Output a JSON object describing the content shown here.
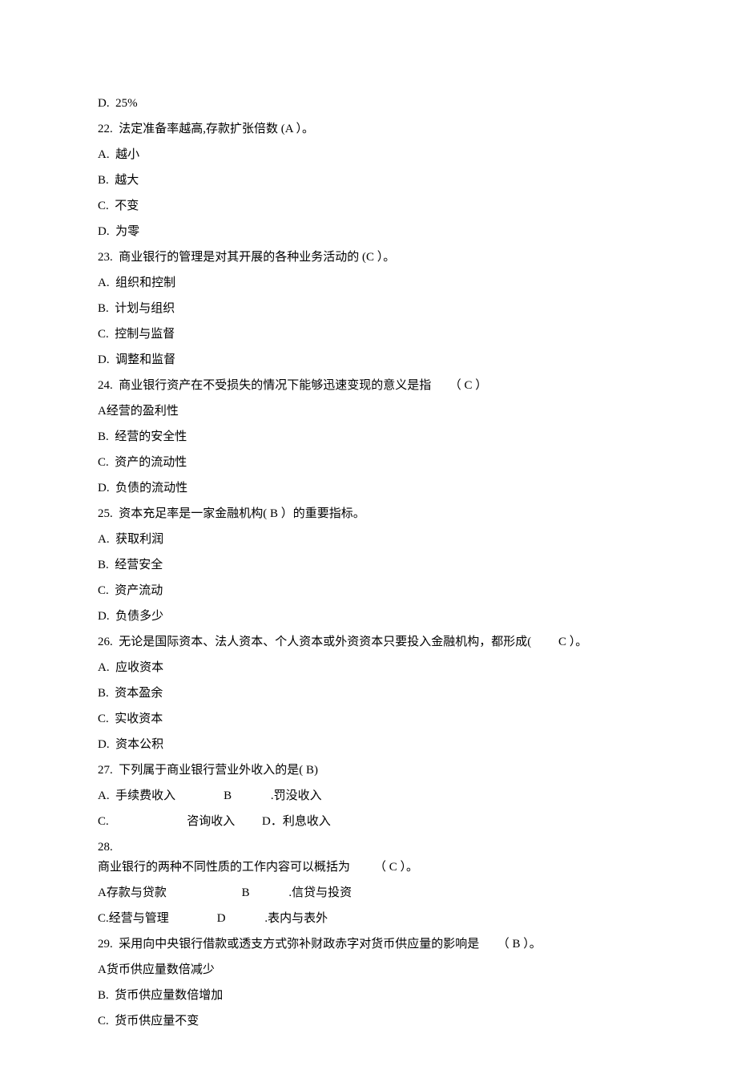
{
  "lines": {
    "l1": "D.  25%",
    "l2": "22.  法定准备率越高,存款扩张倍数 (A ）。",
    "l3": "A.  越小",
    "l4": "B.  越大",
    "l5": "C.  不变",
    "l6": "D.  为零",
    "l7": "23.  商业银行的管理是对其开展的各种业务活动的 (C ）。",
    "l8": "A.  组织和控制",
    "l9": "B.  计划与组织",
    "l10": "C.  控制与监督",
    "l11": "D.  调整和监督",
    "l12": "24.  商业银行资产在不受损失的情况下能够迅速变现的意义是指      （ C ）",
    "l13": "A经营的盈利性",
    "l14": "B.  经营的安全性",
    "l15": "C.  资产的流动性",
    "l16": "D.  负债的流动性",
    "l17": "25.  资本充足率是一家金融机构( B ）的重要指标。",
    "l18": "A.  获取利润",
    "l19": "B.  经营安全",
    "l20": "C.  资产流动",
    "l21": "D.  负债多少",
    "l22": "26.  无论是国际资本、法人资本、个人资本或外资资本只要投入金融机构，都形成(         C ）。",
    "l23": "A.  应收资本",
    "l24": "B.  资本盈余",
    "l25": "C.  实收资本",
    "l26": "D.  资本公积",
    "l27": "27.  下列属于商业银行营业外收入的是( B)",
    "l28": "A.  手续费收入                B             .罚没收入",
    "l29": "C.                          咨询收入         D．利息收入",
    "l30": "28.",
    "l31": "商业银行的两种不同性质的工作内容可以概括为        （ C ）。",
    "l32": "A存款与贷款                         B             .信贷与投资",
    "l33": "C.经营与管理                D             .表内与表外",
    "l34": "29.  采用向中央银行借款或透支方式弥补财政赤字对货币供应量的影响是      （ B ）。",
    "l35": "A货币供应量数倍减少",
    "l36": "B.  货币供应量数倍增加",
    "l37": "C.  货币供应量不变"
  }
}
